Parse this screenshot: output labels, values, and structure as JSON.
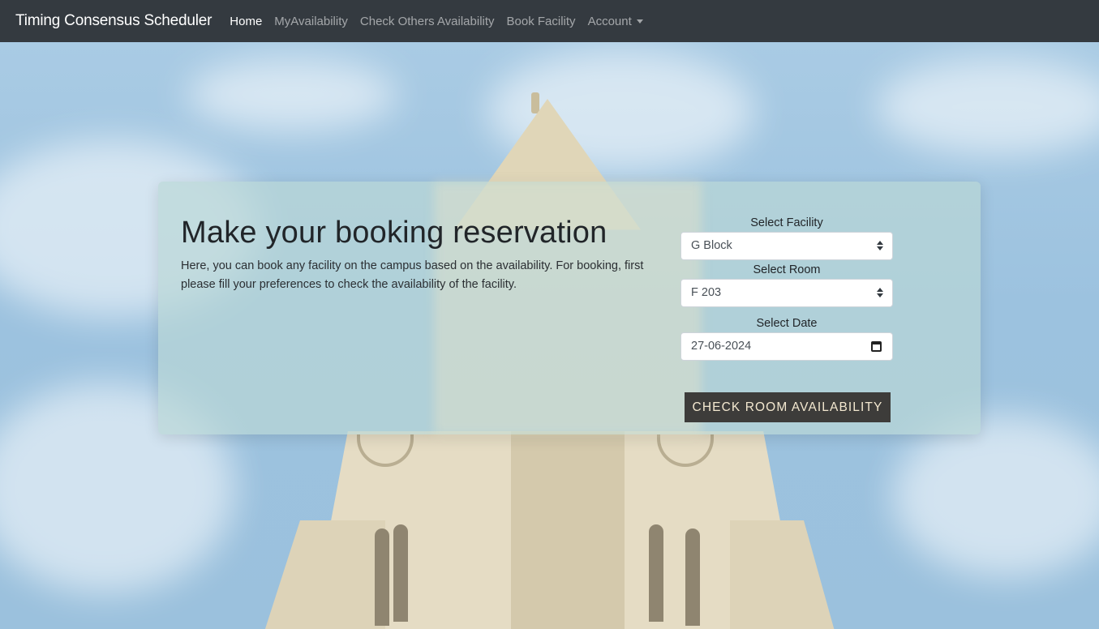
{
  "navbar": {
    "brand": "Timing Consensus Scheduler",
    "links": [
      {
        "label": "Home",
        "active": true
      },
      {
        "label": "MyAvailability",
        "active": false
      },
      {
        "label": "Check Others Availability",
        "active": false
      },
      {
        "label": "Book Facility",
        "active": false
      },
      {
        "label": "Account",
        "active": false,
        "dropdown": true
      }
    ]
  },
  "booking": {
    "title": "Make your booking reservation",
    "description": "Here, you can book any facility on the campus based on the availability. For booking, first please fill your preferences to check the availability of the facility.",
    "facility": {
      "label": "Select Facility",
      "value": "G Block"
    },
    "room": {
      "label": "Select Room",
      "value": "F 203"
    },
    "date": {
      "label": "Select Date",
      "value": "27-06-2024"
    },
    "submit_label": "CHECK ROOM AVAILABILITY"
  },
  "colors": {
    "navbar_bg": "#343a40",
    "button_bg": "#3d3c3a",
    "button_text": "#f3e8d0"
  }
}
